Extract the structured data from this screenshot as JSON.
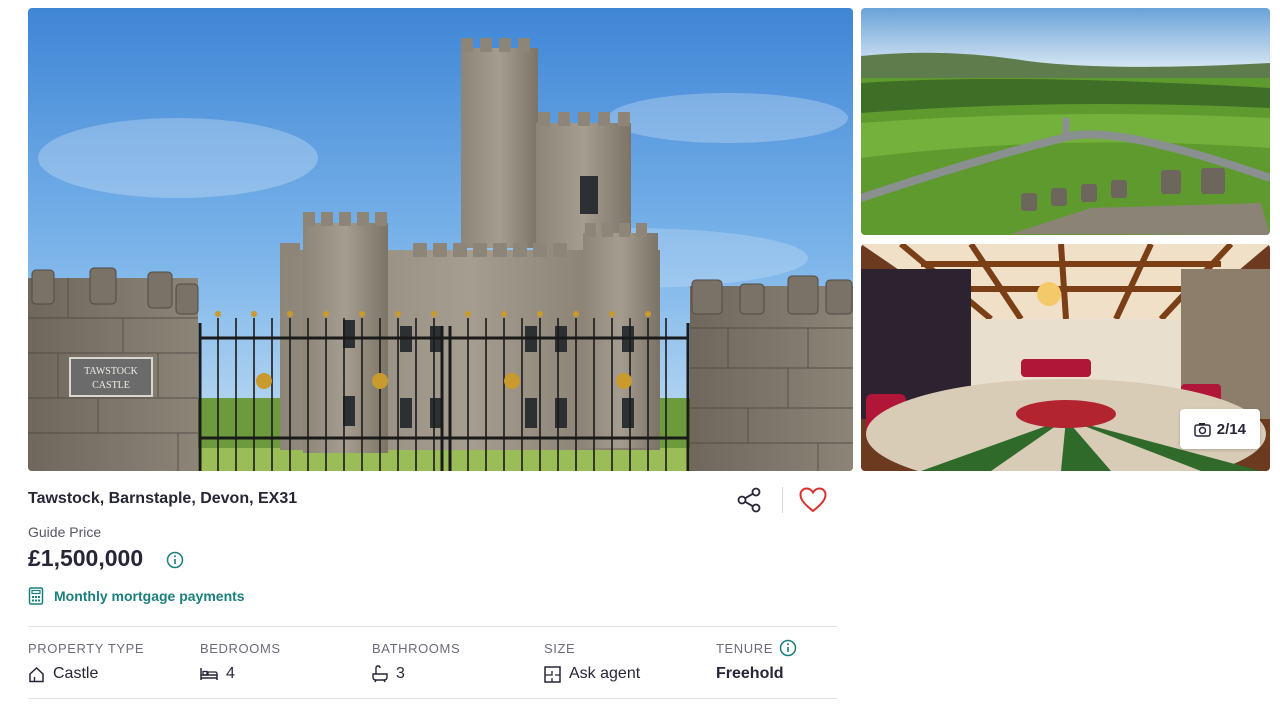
{
  "gallery": {
    "main_photo_alt": "Tawstock Castle exterior",
    "sign_text": [
      "TAWSTOCK",
      "CASTLE"
    ],
    "photo_count": "2/14"
  },
  "listing": {
    "address": "Tawstock, Barnstaple, Devon, EX31",
    "price_label": "Guide Price",
    "price": "£1,500,000",
    "mortgage_link": "Monthly mortgage payments"
  },
  "details": [
    {
      "label": "PROPERTY TYPE",
      "value": "Castle",
      "icon": "house-icon"
    },
    {
      "label": "BEDROOMS",
      "value": "4",
      "icon": "bed-icon"
    },
    {
      "label": "BATHROOMS",
      "value": "3",
      "icon": "bath-icon"
    },
    {
      "label": "SIZE",
      "value": "Ask agent",
      "icon": "floorplan-icon"
    },
    {
      "label": "TENURE",
      "value": "Freehold",
      "icon": "info-icon"
    }
  ],
  "colors": {
    "accent_teal": "#1b7f7c",
    "heart_red": "#d8322e",
    "text": "#262637"
  }
}
